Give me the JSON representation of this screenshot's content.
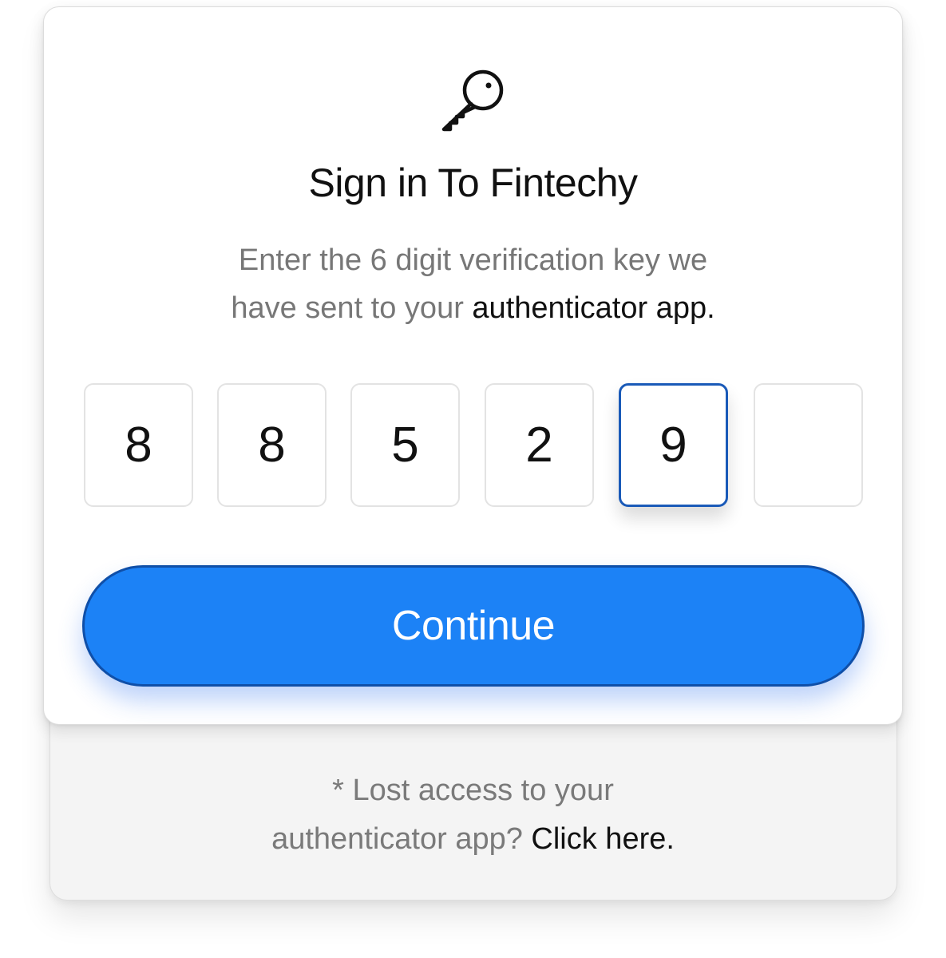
{
  "icon": "key-icon",
  "title": "Sign in To Fintechy",
  "subtitle": {
    "line1": "Enter the 6 digit verification key we",
    "line2_prefix": "have sent to your ",
    "line2_emphasis": "authenticator app."
  },
  "otp": {
    "digits": [
      "8",
      "8",
      "5",
      "2",
      "9",
      ""
    ],
    "active_index": 4
  },
  "continue_label": "Continue",
  "footer": {
    "line1": "* Lost access to your",
    "line2_prefix": "authenticator app? ",
    "link_label": "Click here."
  },
  "colors": {
    "accent": "#1c82f6",
    "accent_border": "#0f4fa8",
    "active_border": "#1a5ab8"
  }
}
